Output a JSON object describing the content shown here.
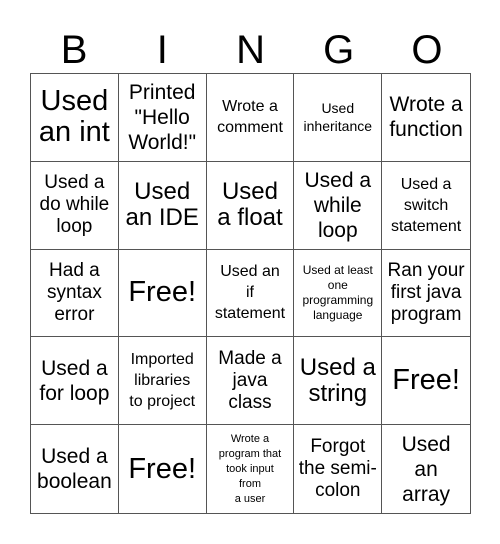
{
  "header": {
    "letters": [
      "B",
      "I",
      "N",
      "G",
      "O"
    ]
  },
  "cells": [
    {
      "text": "Used\nan int",
      "size": "xl"
    },
    {
      "text": "Printed\n\"Hello\nWorld!\"",
      "size": "md"
    },
    {
      "text": "Wrote a\ncomment",
      "size": "sm"
    },
    {
      "text": "Used\ninheritance",
      "size": "xs"
    },
    {
      "text": "Wrote a\nfunction",
      "size": "md"
    },
    {
      "text": "Used a\ndo while\nloop",
      "size": "mn"
    },
    {
      "text": "Used\nan IDE",
      "size": "lg"
    },
    {
      "text": "Used\na float",
      "size": "lg"
    },
    {
      "text": "Used a\nwhile\nloop",
      "size": "md"
    },
    {
      "text": "Used a\nswitch\nstatement",
      "size": "sm"
    },
    {
      "text": "Had a\nsyntax\nerror",
      "size": "mn"
    },
    {
      "text": "Free!",
      "size": "xl"
    },
    {
      "text": "Used an\nif\nstatement",
      "size": "sm"
    },
    {
      "text": "Used at least\none\nprogramming\nlanguage",
      "size": "xxs"
    },
    {
      "text": "Ran your\nfirst java\nprogram",
      "size": "mn"
    },
    {
      "text": "Used a\nfor loop",
      "size": "md"
    },
    {
      "text": "Imported\nlibraries\nto project",
      "size": "sm"
    },
    {
      "text": "Made a\njava\nclass",
      "size": "mn"
    },
    {
      "text": "Used a\nstring",
      "size": "lg"
    },
    {
      "text": "Free!",
      "size": "xl"
    },
    {
      "text": "Used a\nboolean",
      "size": "md"
    },
    {
      "text": "Free!",
      "size": "xl"
    },
    {
      "text": "Wrote a\nprogram that\ntook input\nfrom\na user",
      "size": "tiny"
    },
    {
      "text": "Forgot\nthe semi-\ncolon",
      "size": "mn"
    },
    {
      "text": "Used\nan\narray",
      "size": "md"
    }
  ]
}
